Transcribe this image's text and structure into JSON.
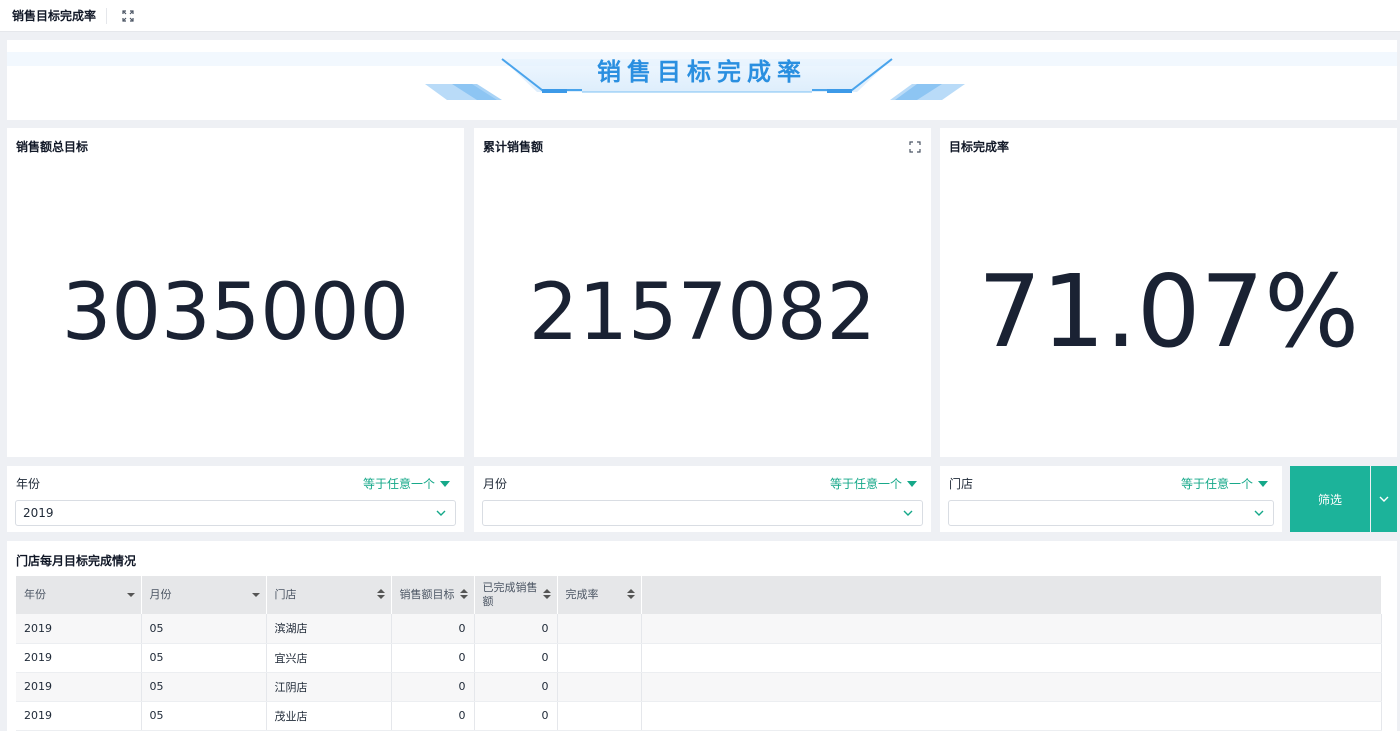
{
  "topbar": {
    "title": "销售目标完成率",
    "expand_icon": "expand-icon"
  },
  "banner": {
    "title": "销售目标完成率",
    "accent": "#2a8fe0"
  },
  "kpis": [
    {
      "title": "销售额总目标",
      "value": "3035000"
    },
    {
      "title": "累计销售额",
      "value": "2157082"
    },
    {
      "title": "目标完成率",
      "value": "71.07%"
    }
  ],
  "filters": [
    {
      "label": "年份",
      "mode": "等于任意一个",
      "value": "2019"
    },
    {
      "label": "月份",
      "mode": "等于任意一个",
      "value": ""
    },
    {
      "label": "门店",
      "mode": "等于任意一个",
      "value": ""
    }
  ],
  "filter_button": {
    "label": "筛选",
    "color": "#1cb39a"
  },
  "table": {
    "title": "门店每月目标完成情况",
    "columns": [
      "年份",
      "月份",
      "门店",
      "销售额目标",
      "已完成销售额",
      "完成率"
    ],
    "rows": [
      [
        "2019",
        "05",
        "滨湖店",
        "0",
        "0",
        ""
      ],
      [
        "2019",
        "05",
        "宜兴店",
        "0",
        "0",
        ""
      ],
      [
        "2019",
        "05",
        "江阴店",
        "0",
        "0",
        ""
      ],
      [
        "2019",
        "05",
        "茂业店",
        "0",
        "0",
        ""
      ]
    ]
  }
}
